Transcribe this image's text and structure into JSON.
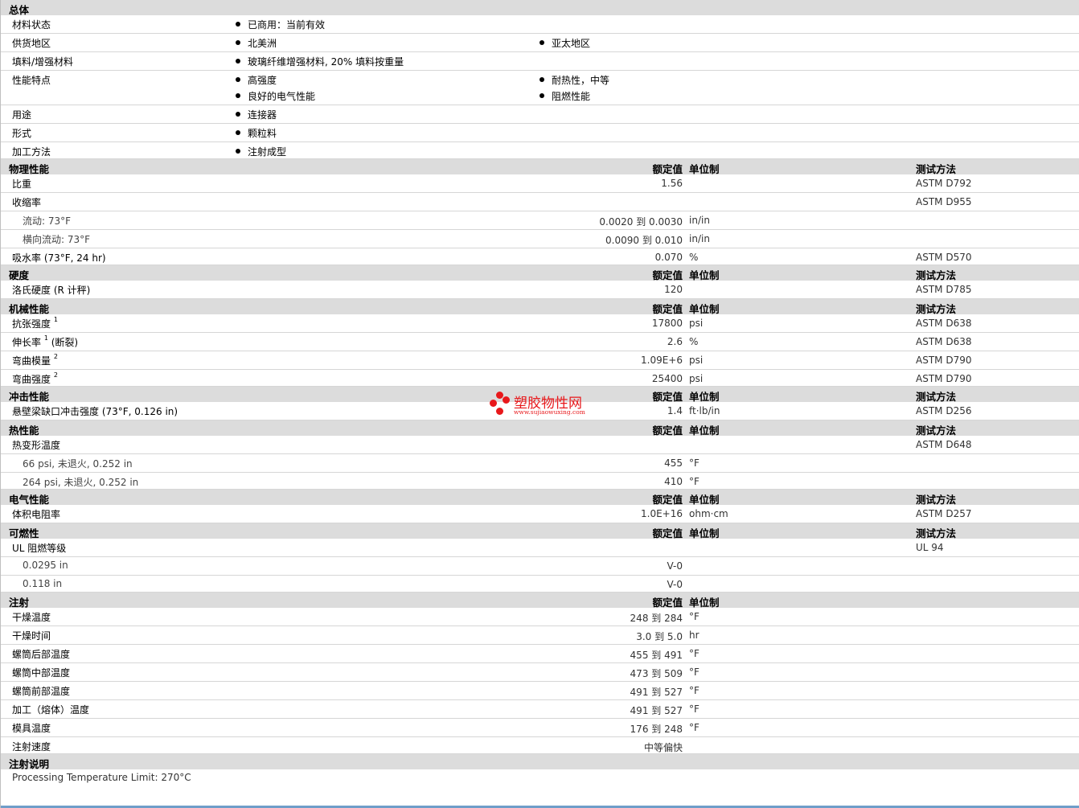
{
  "general": {
    "title": "总体",
    "rows": [
      {
        "label": "材料状态",
        "items": [
          "已商用：当前有效"
        ]
      },
      {
        "label": "供货地区",
        "items": [
          "北美洲",
          "亚太地区"
        ]
      },
      {
        "label": "填料/增强材料",
        "items": [
          "玻璃纤维增强材料, 20% 填料按重量"
        ]
      },
      {
        "label": "性能特点",
        "items": [
          "高强度",
          "耐热性，中等",
          "良好的电气性能",
          "阻燃性能"
        ]
      },
      {
        "label": "用途",
        "items": [
          "连接器"
        ]
      },
      {
        "label": "形式",
        "items": [
          "颗粒料"
        ]
      },
      {
        "label": "加工方法",
        "items": [
          "注射成型"
        ]
      }
    ]
  },
  "col_headers": {
    "value": "额定值",
    "unit": "单位制",
    "method": "测试方法"
  },
  "physical": {
    "title": "物理性能",
    "rows": [
      {
        "label": "比重",
        "value": "1.56",
        "unit": "",
        "method": "ASTM D792"
      },
      {
        "label": "收缩率",
        "value": "",
        "unit": "",
        "method": "ASTM D955"
      },
      {
        "label": "流动: 73°F",
        "value": "0.0020 到  0.0030",
        "unit": "in/in",
        "method": ""
      },
      {
        "label": "横向流动: 73°F",
        "value": "0.0090 到  0.010",
        "unit": "in/in",
        "method": ""
      },
      {
        "label": "吸水率  (73°F, 24 hr)",
        "value": "0.070",
        "unit": "%",
        "method": "ASTM D570"
      }
    ]
  },
  "hardness": {
    "title": "硬度",
    "rows": [
      {
        "label": "洛氏硬度  (R 计秤)",
        "value": "120",
        "unit": "",
        "method": "ASTM D785"
      }
    ]
  },
  "mechanical": {
    "title": "机械性能",
    "rows": [
      {
        "label": "抗张强度",
        "sup": "1",
        "suffix": "",
        "value": "17800",
        "unit": "psi",
        "method": "ASTM D638"
      },
      {
        "label": "伸长率",
        "sup": "1",
        "suffix": " (断裂)",
        "value": "2.6",
        "unit": "%",
        "method": "ASTM D638"
      },
      {
        "label": "弯曲模量",
        "sup": "2",
        "suffix": "",
        "value": "1.09E+6",
        "unit": "psi",
        "method": "ASTM D790"
      },
      {
        "label": "弯曲强度",
        "sup": "2",
        "suffix": "",
        "value": "25400",
        "unit": "psi",
        "method": "ASTM D790"
      }
    ]
  },
  "impact": {
    "title": "冲击性能",
    "rows": [
      {
        "label": "悬壁梁缺口冲击强度  (73°F, 0.126 in)",
        "value": "1.4",
        "unit": "ft·lb/in",
        "method": "ASTM D256"
      }
    ]
  },
  "thermal": {
    "title": "热性能",
    "rows": [
      {
        "label": "热变形温度",
        "value": "",
        "unit": "",
        "method": "ASTM D648"
      },
      {
        "label": "66 psi, 未退火, 0.252 in",
        "value": "455",
        "unit": "°F",
        "method": ""
      },
      {
        "label": "264 psi, 未退火, 0.252 in",
        "value": "410",
        "unit": "°F",
        "method": ""
      }
    ]
  },
  "electrical": {
    "title": "电气性能",
    "rows": [
      {
        "label": "体积电阻率",
        "value": "1.0E+16",
        "unit": "ohm·cm",
        "method": "ASTM D257"
      }
    ]
  },
  "flammability": {
    "title": "可燃性",
    "rows": [
      {
        "label": "UL 阻燃等级",
        "value": "",
        "unit": "",
        "method": "UL 94"
      },
      {
        "label": "0.0295 in",
        "value": "V-0",
        "unit": "",
        "method": ""
      },
      {
        "label": "0.118 in",
        "value": "V-0",
        "unit": "",
        "method": ""
      }
    ]
  },
  "injection": {
    "title": "注射",
    "rows": [
      {
        "label": "干燥温度",
        "value": "248 到  284",
        "unit": "°F"
      },
      {
        "label": "干燥时间",
        "value": "3.0 到  5.0",
        "unit": "hr"
      },
      {
        "label": "螺筒后部温度",
        "value": "455 到  491",
        "unit": "°F"
      },
      {
        "label": "螺筒中部温度",
        "value": "473 到  509",
        "unit": "°F"
      },
      {
        "label": "螺筒前部温度",
        "value": "491 到  527",
        "unit": "°F"
      },
      {
        "label": "加工（熔体）温度",
        "value": "491 到  527",
        "unit": "°F"
      },
      {
        "label": "模具温度",
        "value": "176 到  248",
        "unit": "°F"
      },
      {
        "label": "注射速度",
        "value": "中等偏快",
        "unit": ""
      }
    ]
  },
  "injection_notes": {
    "title": "注射说明",
    "text": "Processing Temperature Limit: 270°C"
  },
  "watermark": {
    "name": "塑胶物性网",
    "url": "www.sujiaowuxing.com"
  }
}
